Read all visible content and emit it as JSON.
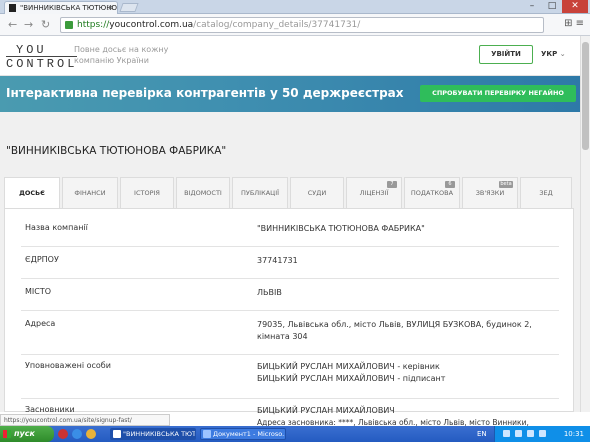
{
  "browser": {
    "tab_title": "\"ВИННИКІВСЬКА ТЮТЮНОВ",
    "url_scheme": "https://",
    "url_host": "youcontrol.com.ua",
    "url_path": "/catalog/company_details/37741731/"
  },
  "site": {
    "logo_line1": "YOU",
    "logo_line2": "CONTROL",
    "tagline_1": "Повне досьє на кожну",
    "tagline_2": "компанію України",
    "login_label": "УВІЙТИ",
    "lang_label": "УКР"
  },
  "banner": {
    "text": "Інтерактивна перевірка контрагентів у 50 держреєстрах",
    "button_label": "СПРОБУВАТИ ПЕРЕВІРКУ НЕГАЙНО"
  },
  "company": {
    "title": "\"ВИННИКІВСЬКА ТЮТЮНОВА ФАБРИКА\""
  },
  "tabs": [
    {
      "label": "ДОСЬЄ",
      "badge": ""
    },
    {
      "label": "ФІНАНСИ",
      "badge": ""
    },
    {
      "label": "ІСТОРІЯ",
      "badge": ""
    },
    {
      "label": "ВІДОМОСТІ",
      "badge": ""
    },
    {
      "label": "ПУБЛІКАЦІЇ",
      "badge": ""
    },
    {
      "label": "СУДИ",
      "badge": ""
    },
    {
      "label": "ЛІЦЕНЗІЇ",
      "badge": "7"
    },
    {
      "label": "ПОДАТКОВА",
      "badge": "6"
    },
    {
      "label": "ЗВ'ЯЗКИ",
      "badge": "beta"
    },
    {
      "label": "ЗЕД",
      "badge": ""
    }
  ],
  "details": [
    {
      "key": "Назва компанії",
      "value": "\"ВИННИКІВСЬКА ТЮТЮНОВА ФАБРИКА\""
    },
    {
      "key": "ЄДРПОУ",
      "value": "37741731"
    },
    {
      "key": "МІСТО",
      "value": "ЛЬВІВ"
    },
    {
      "key": "Адреса",
      "value": "79035, Львівська обл., місто Львів, ВУЛИЦЯ БУЗКОВА, будинок 2, кімната 304"
    },
    {
      "key": "Уповноважені особи",
      "value": "БИЦЬКИЙ РУСЛАН МИХАЙЛОВИЧ - керівник",
      "value2": "БИЦЬКИЙ РУСЛАН МИХАЙЛОВИЧ - підписант"
    },
    {
      "key": "Засновники",
      "value": "БИЦЬКИЙ РУСЛАН МИХАЙЛОВИЧ",
      "value2": "Адреса засновника: ****, Львівська обл., місто Львів, місто Винники,"
    }
  ],
  "status_url": "https://youcontrol.com.ua/site/signup-fast/",
  "taskbar": {
    "start_label": "пуск",
    "task1": "\"ВИННИКІВСЬКА ТЮТ...",
    "task2": "Документ1 - Microso...",
    "lang": "EN",
    "time": "10:31"
  }
}
